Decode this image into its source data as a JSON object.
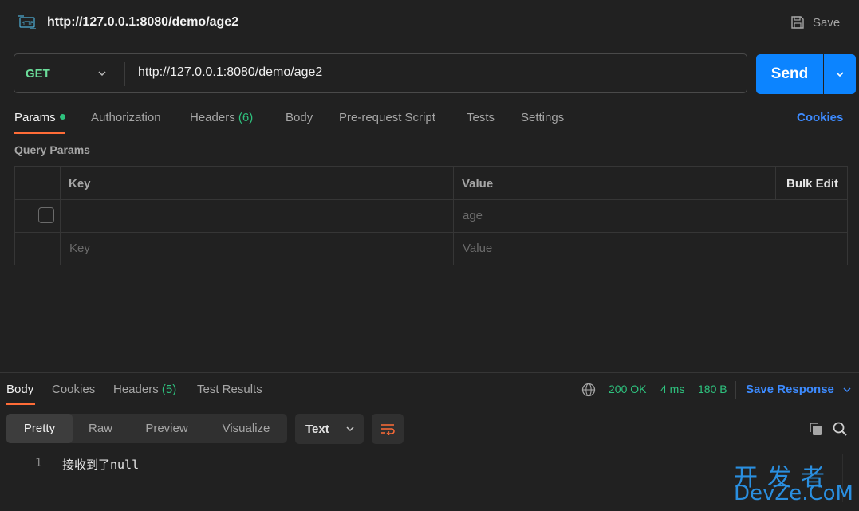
{
  "request": {
    "title": "http://127.0.0.1:8080/demo/age2",
    "save_label": "Save",
    "method": "GET",
    "url": "http://127.0.0.1:8080/demo/age2",
    "send_label": "Send"
  },
  "tabs": {
    "params": "Params",
    "authorization": "Authorization",
    "headers": "Headers",
    "headers_count": "(6)",
    "body": "Body",
    "prerequest": "Pre-request Script",
    "tests": "Tests",
    "settings": "Settings",
    "cookies": "Cookies"
  },
  "params": {
    "section_label": "Query Params",
    "columns": {
      "key": "Key",
      "value": "Value",
      "bulk_edit": "Bulk Edit"
    },
    "rows": [
      {
        "key": "",
        "value_placeholder": "age",
        "checked": false
      }
    ],
    "new_row": {
      "key_placeholder": "Key",
      "value_placeholder": "Value"
    }
  },
  "response": {
    "tabs": {
      "body": "Body",
      "cookies": "Cookies",
      "headers": "Headers",
      "headers_count": "(5)",
      "test_results": "Test Results"
    },
    "status": "200 OK",
    "time": "4 ms",
    "size": "180 B",
    "save_response": "Save Response",
    "views": [
      "Pretty",
      "Raw",
      "Preview",
      "Visualize"
    ],
    "format": "Text",
    "lines": [
      {
        "number": "1",
        "text": "接收到了null"
      }
    ]
  },
  "watermark": {
    "cn": "开发者",
    "en": "DevZe.CoM"
  },
  "colors": {
    "accent_orange": "#ff6c37",
    "send_blue": "#0c84ff",
    "link_blue": "#3d8bff",
    "status_green": "#2ec27e",
    "method_green": "#6bdd9a"
  }
}
